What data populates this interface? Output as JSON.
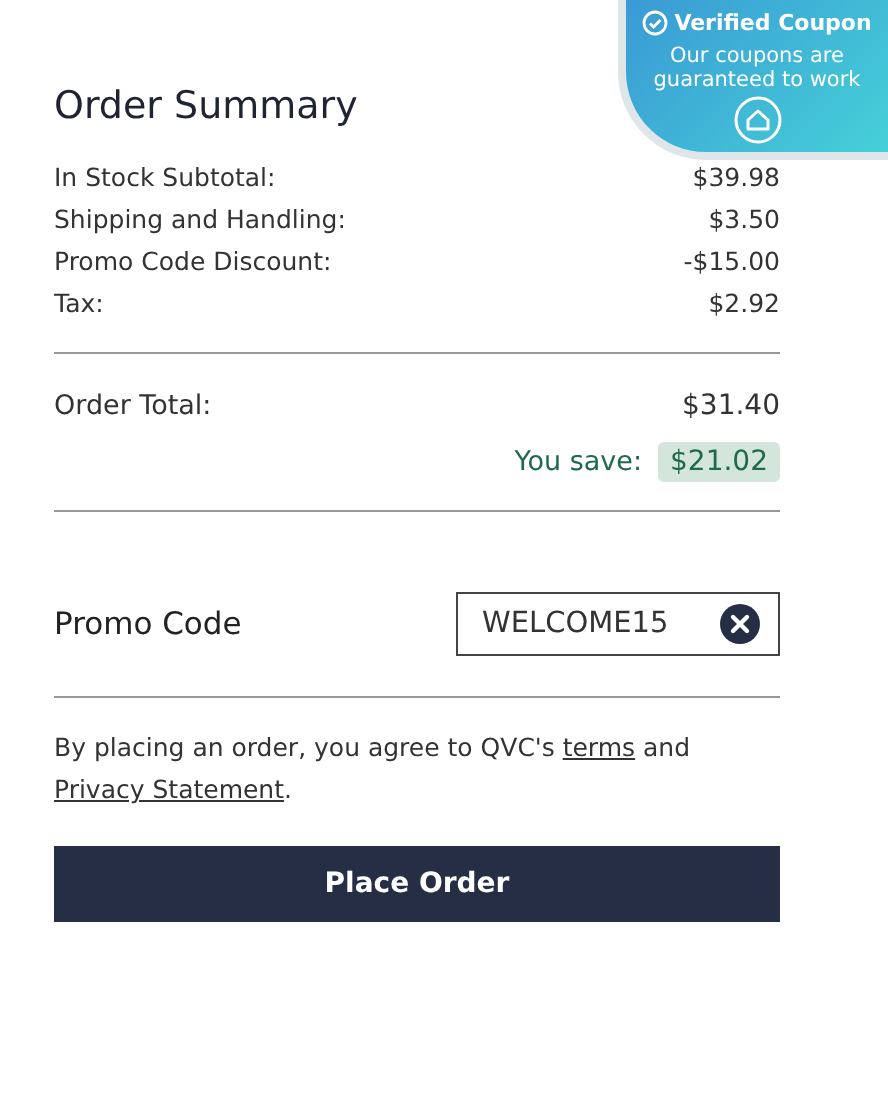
{
  "summary": {
    "title": "Order Summary",
    "lines": [
      {
        "label": "In Stock Subtotal:",
        "value": "$39.98"
      },
      {
        "label": "Shipping and Handling:",
        "value": "$3.50"
      },
      {
        "label": "Promo Code Discount:",
        "value": "-$15.00"
      },
      {
        "label": "Tax:",
        "value": "$2.92"
      }
    ],
    "total": {
      "label": "Order Total:",
      "value": "$31.40"
    },
    "savings": {
      "label": "You save:",
      "value": "$21.02"
    }
  },
  "promo": {
    "label": "Promo Code",
    "value": "WELCOME15"
  },
  "terms": {
    "before": "By placing an order, you agree to QVC's ",
    "link1": "terms",
    "middle": " and ",
    "link2": "Privacy Statement",
    "after": "."
  },
  "place_order": "Place Order",
  "coupon_badge": {
    "title": "Verified Coupon",
    "text": "Our coupons are guaranteed to work"
  }
}
